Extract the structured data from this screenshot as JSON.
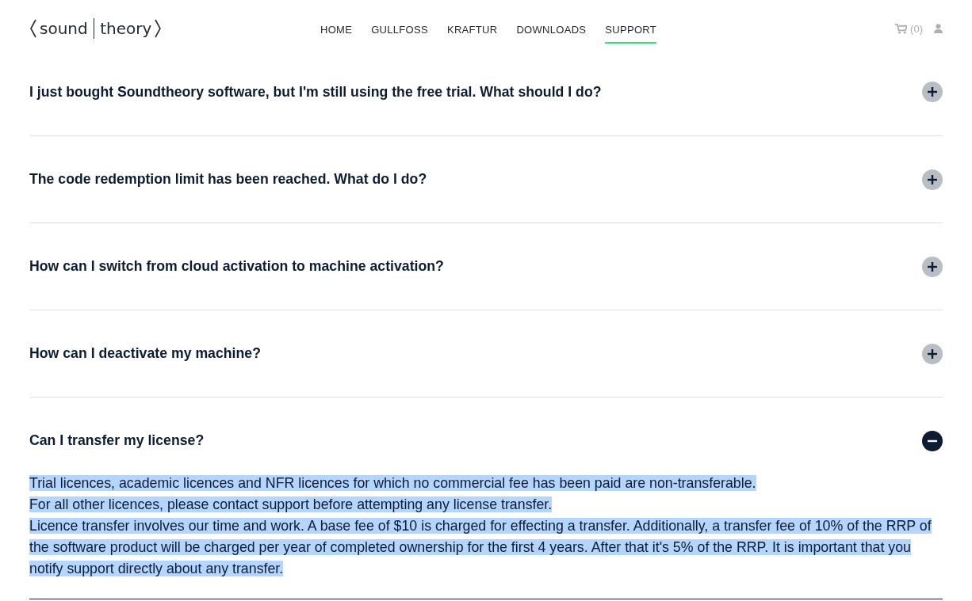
{
  "logo": {
    "left": "sound",
    "right": "theory"
  },
  "nav": [
    {
      "label": "HOME",
      "selected": false
    },
    {
      "label": "GULLFOSS",
      "selected": false
    },
    {
      "label": "KRAFTUR",
      "selected": false
    },
    {
      "label": "DOWNLOADS",
      "selected": false
    },
    {
      "label": "SUPPORT",
      "selected": true
    }
  ],
  "cart": {
    "count": "(0)"
  },
  "faq": [
    {
      "question": "I just bought Soundtheory software, but I'm still using the free trial. What should I do?",
      "expanded": false
    },
    {
      "question": "The code redemption limit has been reached. What do I do?",
      "expanded": false
    },
    {
      "question": "How can I switch from cloud activation to machine activation?",
      "expanded": false
    },
    {
      "question": "How can I deactivate my machine?",
      "expanded": false
    },
    {
      "question": "Can I transfer my license?",
      "expanded": true,
      "answer_selected": true,
      "answer": [
        "Trial licences, academic licences and NFR licences for which no commercial fee has been paid are non-transferable.",
        "For all other licences, please contact support before attempting any license transfer.",
        "Licence transfer involves our time and work. A base fee of $10 is charged for effecting a transfer. Additionally, a transfer fee of 10% of the RRP of the software product will be charged per year of completed ownership for the first 4 years. After that it's 5% of the RRP. It is important that you notify support directly about any transfer."
      ]
    }
  ]
}
